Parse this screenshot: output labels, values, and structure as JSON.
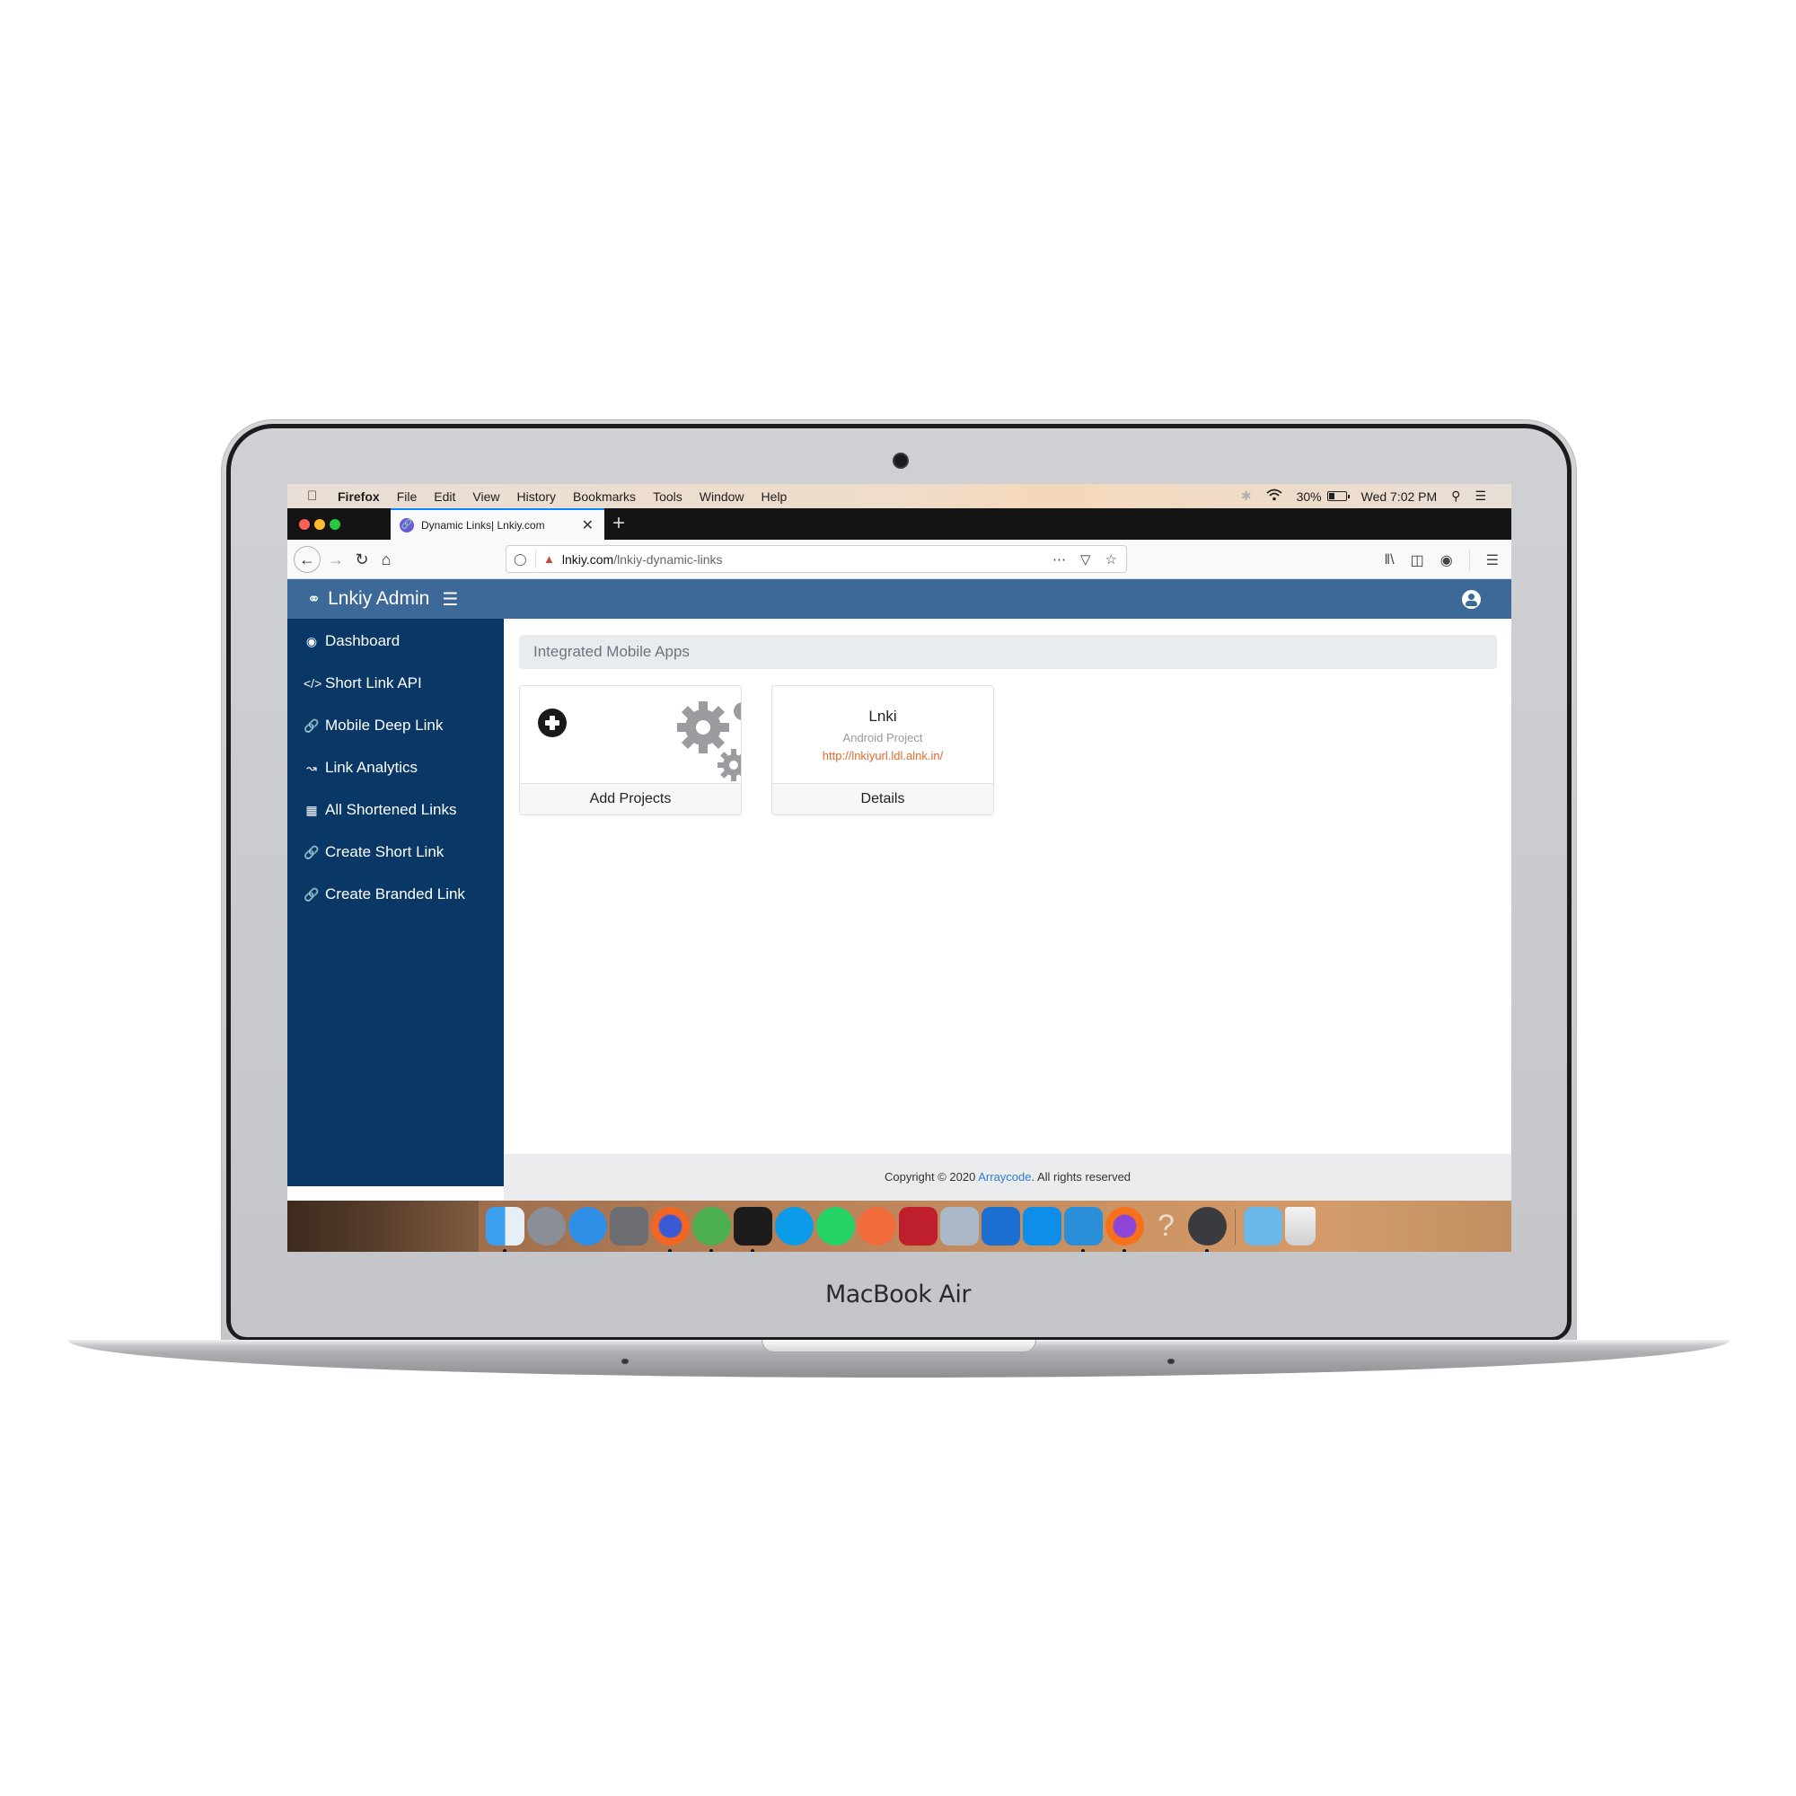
{
  "device": {
    "brand_label": "MacBook Air"
  },
  "menubar": {
    "app_name": "Firefox",
    "items": [
      "File",
      "Edit",
      "View",
      "History",
      "Bookmarks",
      "Tools",
      "Window",
      "Help"
    ],
    "battery": "30%",
    "clock": "Wed 7:02 PM"
  },
  "browser": {
    "tab_title": "Dynamic Links| Lnkiy.com",
    "url_host": "lnkiy.com",
    "url_path": "/lnkiy-dynamic-links"
  },
  "app": {
    "title": "Lnkiy Admin",
    "sidebar": [
      {
        "label": "Dashboard",
        "icon": "tachometer-icon"
      },
      {
        "label": "Short Link API",
        "icon": "code-icon"
      },
      {
        "label": "Mobile Deep Link",
        "icon": "link-icon"
      },
      {
        "label": "Link Analytics",
        "icon": "line-chart-icon"
      },
      {
        "label": "All Shortened Links",
        "icon": "table-icon"
      },
      {
        "label": "Create Short Link",
        "icon": "link-icon"
      },
      {
        "label": "Create Branded Link",
        "icon": "link-icon"
      }
    ],
    "breadcrumb": "Integrated Mobile Apps",
    "cards": [
      {
        "footer": "Add Projects"
      },
      {
        "name": "Lnki",
        "type": "Android Project",
        "url": "http://lnkiyurl.ldl.alnk.in/",
        "footer": "Details"
      }
    ],
    "footer": {
      "prefix": "Copyright © 2020 ",
      "link": "Arraycode",
      "suffix": ". All rights reserved"
    }
  },
  "dock": {
    "apps": [
      "Finder",
      "Launchpad",
      "Safari",
      "System Preferences",
      "Firefox",
      "Spring Tool Suite",
      "Terminal",
      "Skype",
      "WhatsApp",
      "Postman",
      "FileZilla",
      "VirtualBox",
      "Sublime/Docs",
      "TeamViewer",
      "VS Code",
      "Firefox Developer",
      "Help",
      "Sequel/Elephant",
      "Downloads",
      "Trash"
    ]
  }
}
